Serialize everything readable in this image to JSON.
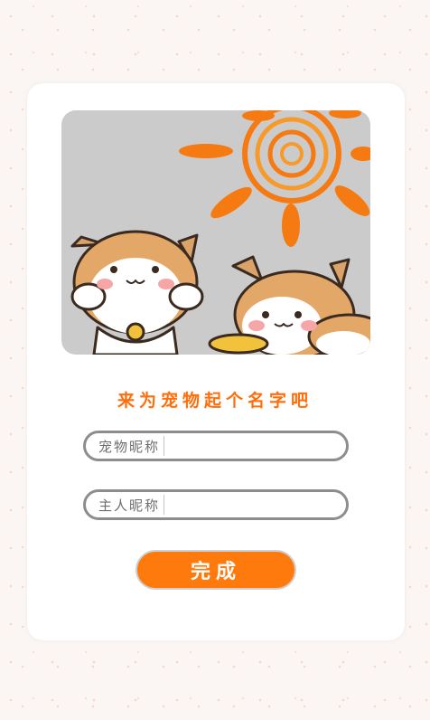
{
  "header": {
    "title": "来为宠物起个名字吧"
  },
  "form": {
    "pet_name": {
      "label": "宠物昵称",
      "value": ""
    },
    "owner_name": {
      "label": "主人昵称",
      "value": ""
    },
    "submit_label": "完成"
  },
  "colors": {
    "accent": "#ff7a0c",
    "title": "#ff6e0a",
    "field_border": "#8d8d8d",
    "hero_bg": "#cbcbcb"
  }
}
